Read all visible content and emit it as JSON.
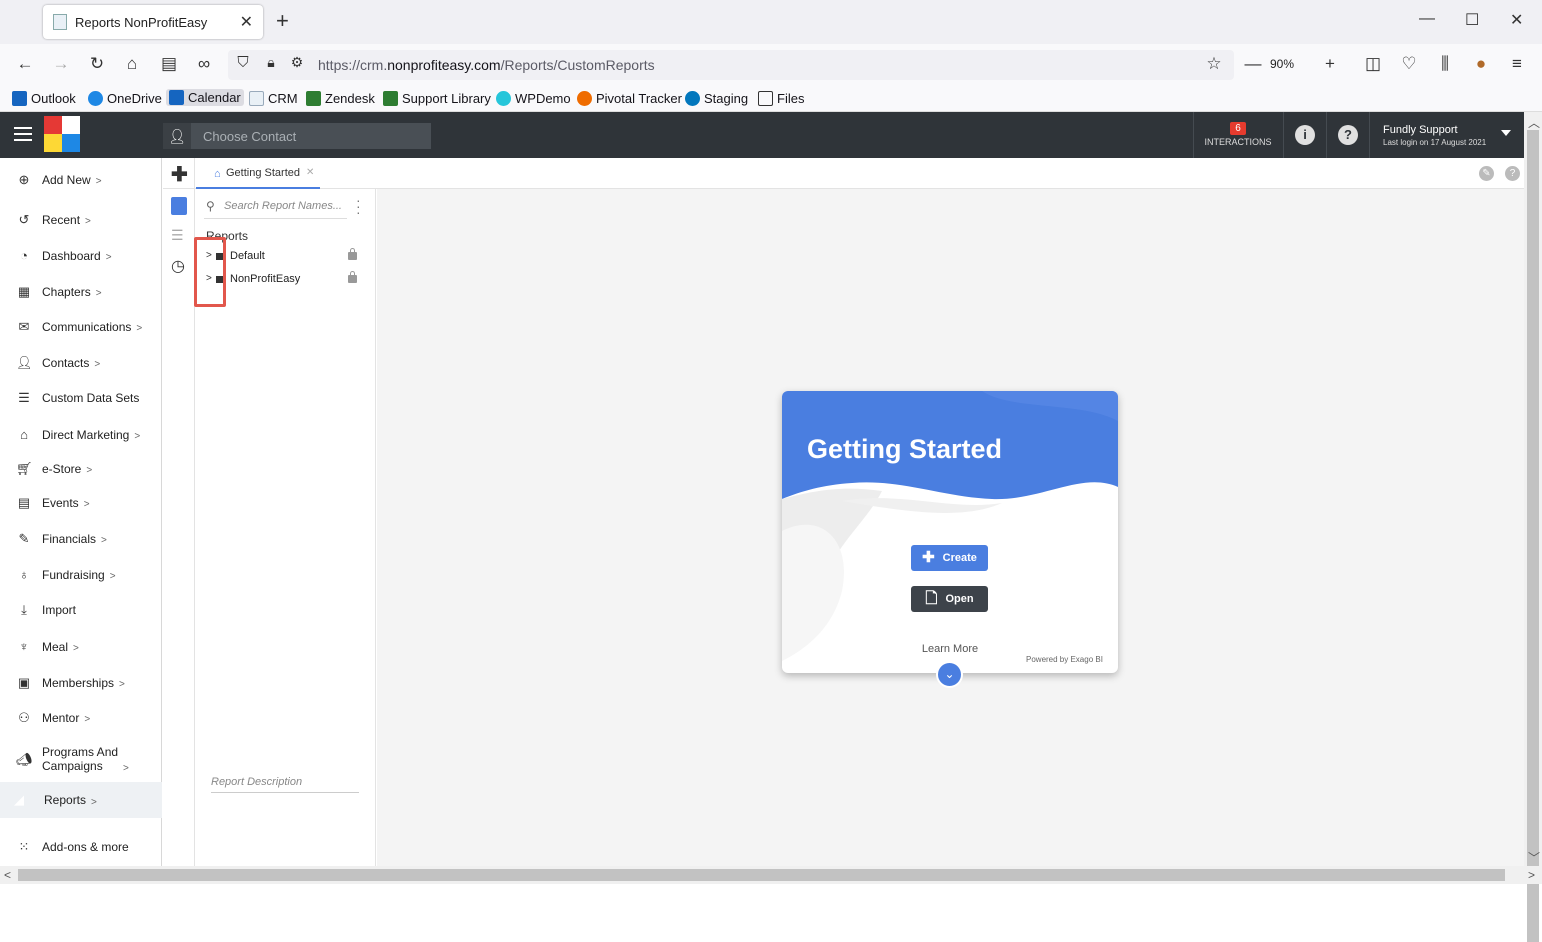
{
  "browser": {
    "tab_title": "Reports NonProfitEasy",
    "url_prefix": "https://crm.",
    "url_domain": "nonprofiteasy.com",
    "url_path": "/Reports/CustomReports",
    "zoom": "90%",
    "bookmarks": [
      "Outlook",
      "OneDrive",
      "Calendar",
      "CRM",
      "Zendesk",
      "Support Library",
      "WPDemo",
      "Pivotal Tracker",
      "Staging",
      "Files"
    ]
  },
  "header": {
    "contact_placeholder": "Choose Contact",
    "interactions_count": "6",
    "interactions_label": "INTERACTIONS",
    "user_name": "Fundly Support",
    "last_login": "Last login on 17 August 2021"
  },
  "nav": {
    "items": [
      "Add New",
      "Recent",
      "Dashboard",
      "Chapters",
      "Communications",
      "Contacts",
      "Custom Data Sets",
      "Direct Marketing",
      "e-Store",
      "Events",
      "Financials",
      "Fundraising",
      "Import",
      "Meal",
      "Memberships",
      "Mentor",
      "Programs And",
      "Campaigns",
      "Reports",
      "Add-ons & more"
    ]
  },
  "designer": {
    "tab_label": "Getting Started",
    "search_placeholder": "Search Report Names...",
    "tree_header": "Reports",
    "folders": [
      "Default",
      "NonProfitEasy"
    ],
    "description_placeholder": "Report Description"
  },
  "card": {
    "title": "Getting Started",
    "create_label": "Create",
    "open_label": "Open",
    "learn_more": "Learn More",
    "powered_by": "Powered by Exago BI"
  },
  "colors": {
    "accent": "#4a7ee0",
    "header_bg": "#2f3439",
    "highlight": "#e2574c"
  }
}
